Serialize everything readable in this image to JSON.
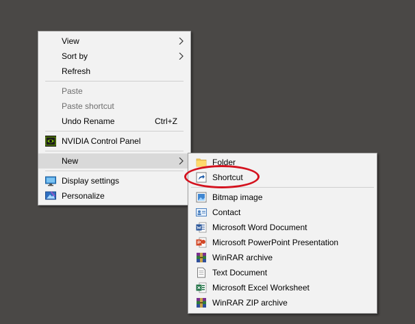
{
  "context_menu": {
    "items": [
      {
        "label": "View"
      },
      {
        "label": "Sort by"
      },
      {
        "label": "Refresh"
      },
      {
        "label": "Paste"
      },
      {
        "label": "Paste shortcut"
      },
      {
        "label": "Undo Rename",
        "shortcut": "Ctrl+Z"
      },
      {
        "label": "NVIDIA Control Panel"
      },
      {
        "label": "New"
      },
      {
        "label": "Display settings"
      },
      {
        "label": "Personalize"
      }
    ]
  },
  "new_submenu": {
    "items": [
      {
        "label": "Folder"
      },
      {
        "label": "Shortcut"
      },
      {
        "label": "Bitmap image"
      },
      {
        "label": "Contact"
      },
      {
        "label": "Microsoft Word Document"
      },
      {
        "label": "Microsoft PowerPoint Presentation"
      },
      {
        "label": "WinRAR archive"
      },
      {
        "label": "Text Document"
      },
      {
        "label": "Microsoft Excel Worksheet"
      },
      {
        "label": "WinRAR ZIP archive"
      }
    ]
  },
  "colors": {
    "desktop_background": "#4a4846",
    "menu_background": "#f2f2f2",
    "hover_background": "#d9d9d9",
    "disabled_text": "#6d6d6d",
    "annotation_red": "#d4121e"
  },
  "icons": {
    "nvidia": "nvidia-icon",
    "display": "display-settings-icon",
    "personalize": "personalize-icon",
    "folder": "folder-icon",
    "shortcut": "shortcut-icon",
    "bitmap": "bitmap-icon",
    "contact": "contact-icon",
    "word": "word-icon",
    "powerpoint": "powerpoint-icon",
    "winrar": "winrar-icon",
    "text": "text-document-icon",
    "excel": "excel-icon",
    "zip": "winrar-zip-icon"
  }
}
